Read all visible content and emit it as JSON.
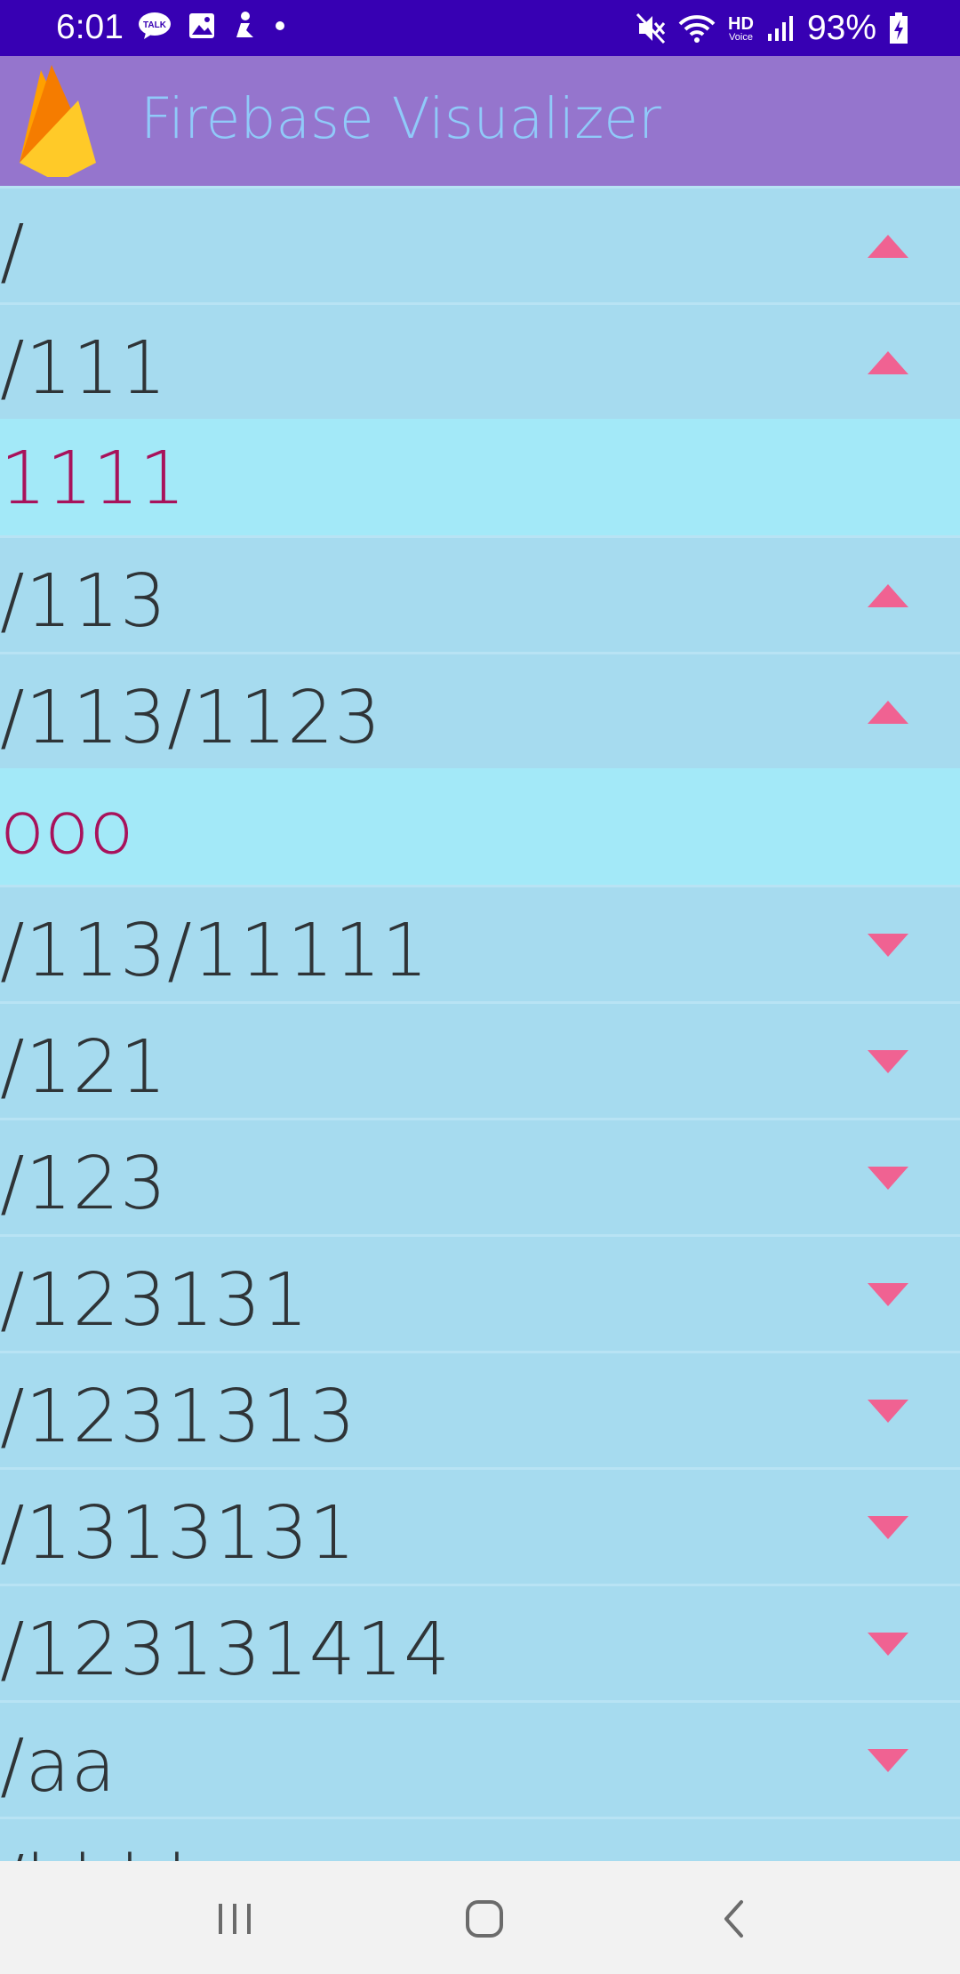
{
  "status_bar": {
    "time": "6:01",
    "notification_icons": [
      "talk-icon",
      "image-icon",
      "person-icon",
      "dot-icon"
    ],
    "system_icons": [
      "mute-icon",
      "wifi-icon",
      "hd-voice-icon",
      "signal-icon"
    ],
    "hd_label": "HD",
    "voice_label": "Voice",
    "battery_percent": "93%"
  },
  "app_bar": {
    "title": "Firebase Visualizer",
    "colors": {
      "background": "#9575cd",
      "title": "#90caf9"
    }
  },
  "tree": {
    "items": [
      {
        "kind": "node",
        "path": "/",
        "expanded": true
      },
      {
        "kind": "node",
        "path": "/111",
        "expanded": true
      },
      {
        "kind": "value",
        "text": "1111"
      },
      {
        "kind": "node",
        "path": "/113",
        "expanded": true
      },
      {
        "kind": "node",
        "path": "/113/1123",
        "expanded": true
      },
      {
        "kind": "value",
        "text": "ooo"
      },
      {
        "kind": "node",
        "path": "/113/11111",
        "expanded": false
      },
      {
        "kind": "node",
        "path": "/121",
        "expanded": false
      },
      {
        "kind": "node",
        "path": "/123",
        "expanded": false
      },
      {
        "kind": "node",
        "path": "/123131",
        "expanded": false
      },
      {
        "kind": "node",
        "path": "/1231313",
        "expanded": false
      },
      {
        "kind": "node",
        "path": "/1313131",
        "expanded": false
      },
      {
        "kind": "node",
        "path": "/123131414",
        "expanded": false
      },
      {
        "kind": "node",
        "path": "/aa",
        "expanded": false
      },
      {
        "kind": "node",
        "path": "/bbbb",
        "expanded": false
      }
    ],
    "colors": {
      "node_background": "#a6dbef",
      "value_background": "#a3e9f8",
      "value_text": "#a8125b",
      "arrow": "#f06292"
    }
  },
  "nav_bar": {
    "buttons": [
      "recent-apps-icon",
      "home-icon",
      "back-icon"
    ]
  }
}
